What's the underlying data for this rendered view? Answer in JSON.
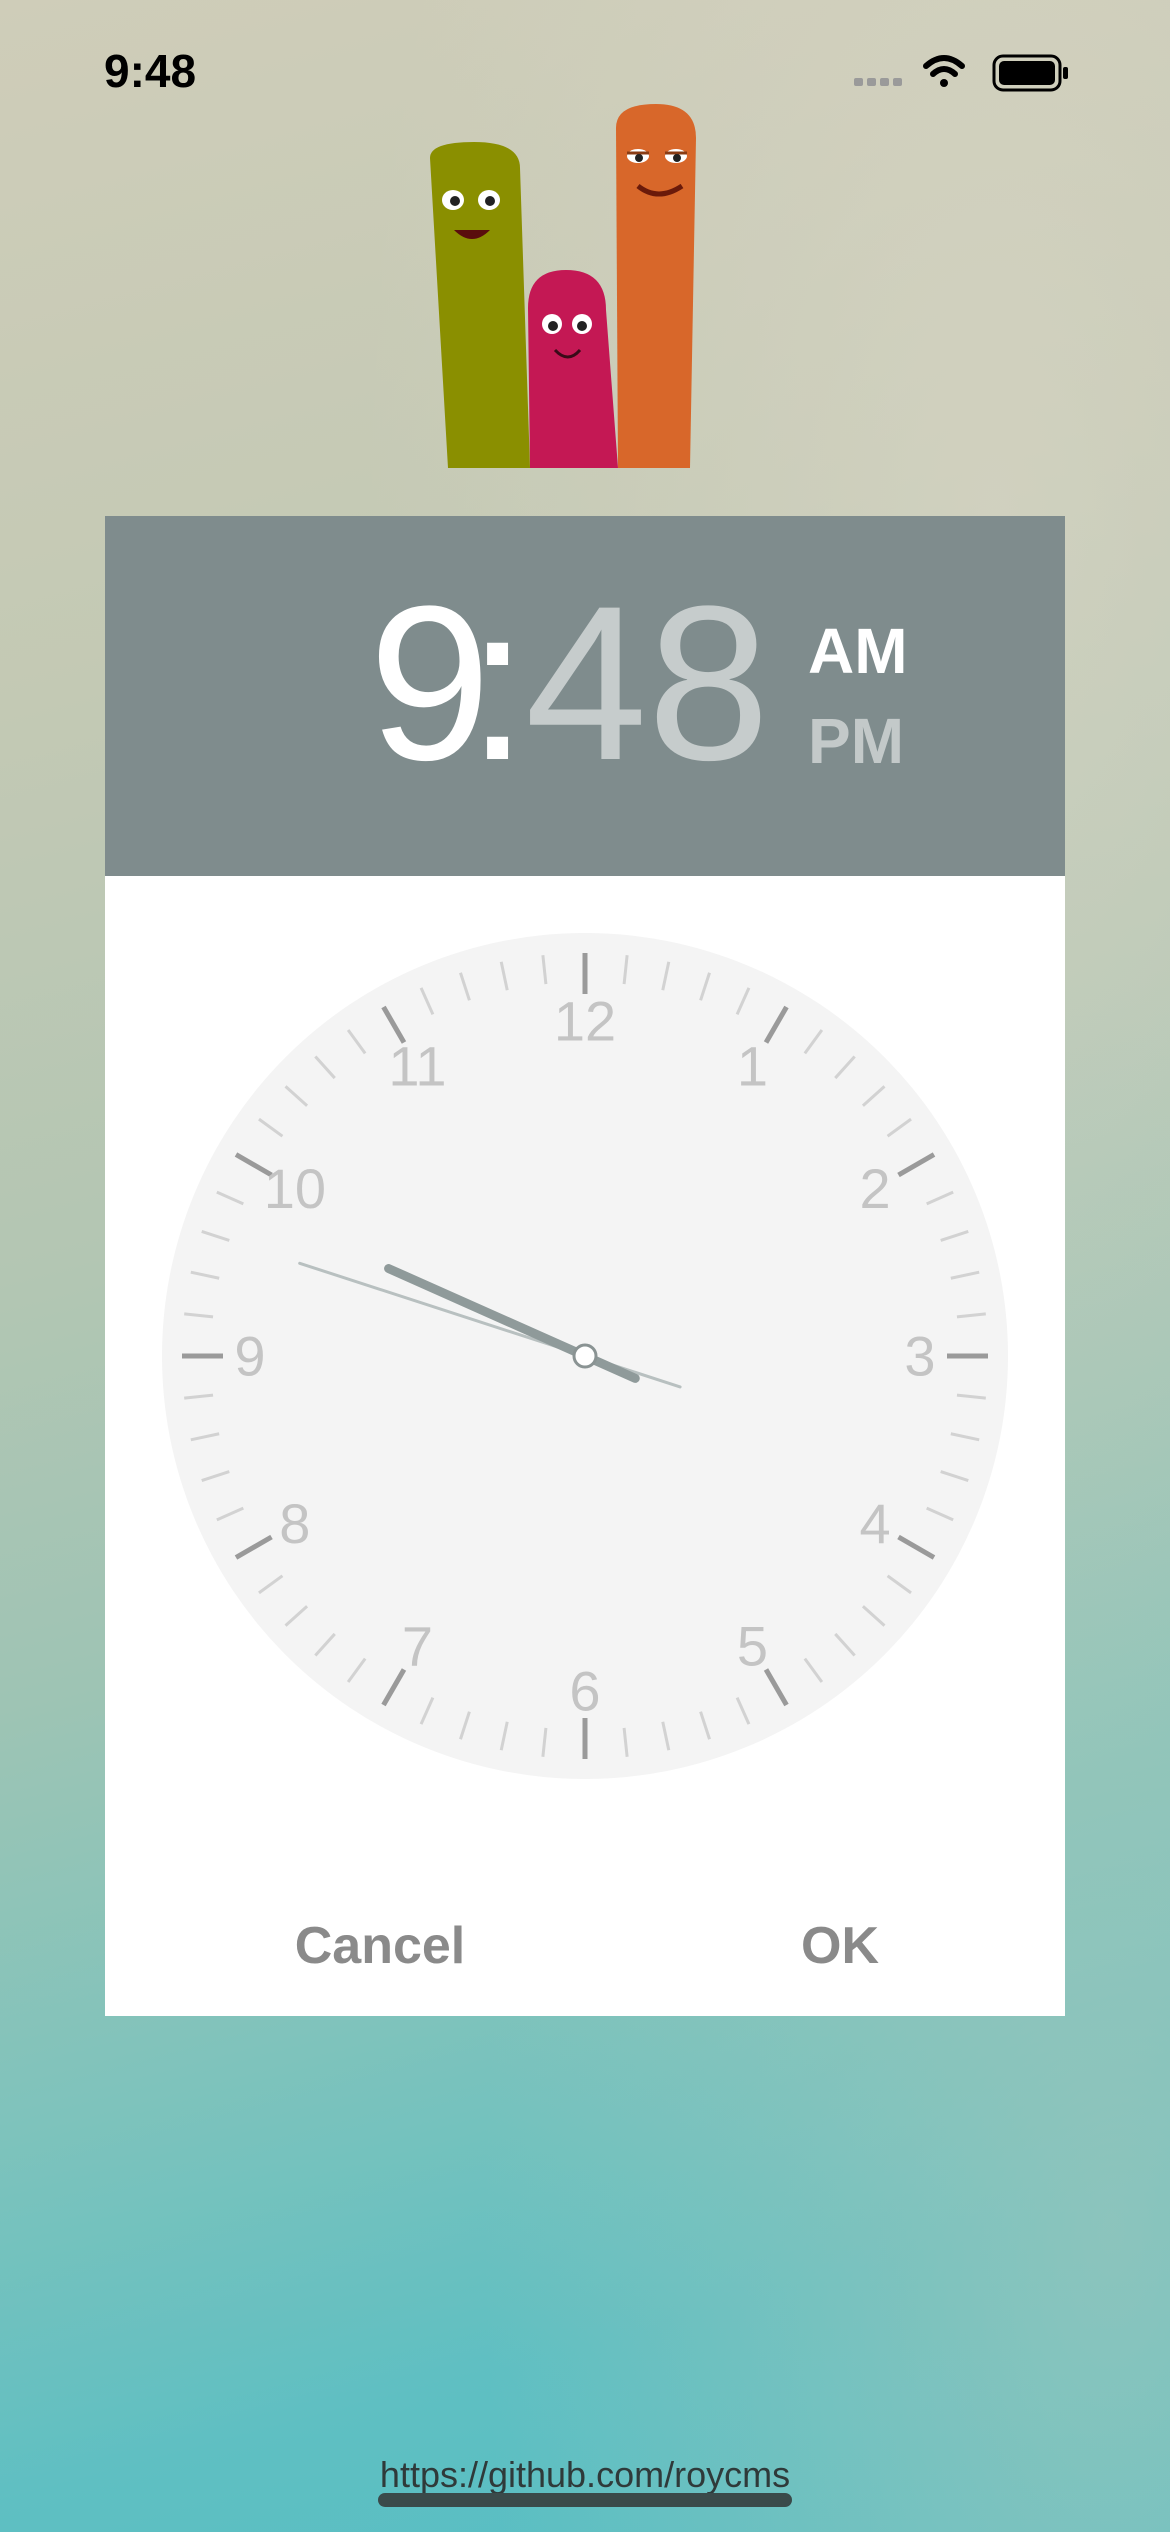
{
  "status_bar": {
    "time": "9:48",
    "icons": [
      "signal-icon",
      "wifi-icon",
      "battery-icon"
    ]
  },
  "background_text": "",
  "dialog": {
    "hour": "9",
    "colon": ":",
    "minute": "48",
    "am_label": "AM",
    "pm_label": "PM",
    "selected_period": "AM",
    "header_color": "#7f8c8d",
    "clock": {
      "numbers": [
        "12",
        "1",
        "2",
        "3",
        "4",
        "5",
        "6",
        "7",
        "8",
        "9",
        "10",
        "11"
      ],
      "hour_value": 9,
      "minute_value": 48,
      "face_color": "#f4f4f4",
      "hand_color": "#8f9a9a"
    },
    "cancel_label": "Cancel",
    "ok_label": "OK"
  },
  "footer": {
    "link": "https://github.com/roycms"
  }
}
